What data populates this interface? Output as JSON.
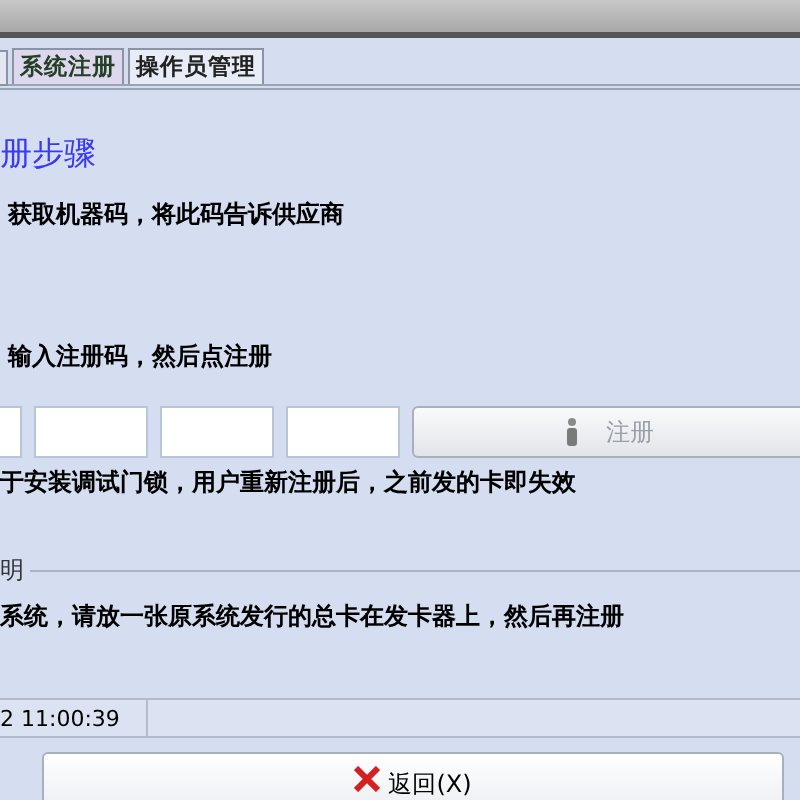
{
  "tabs": [
    {
      "label": "系统注册",
      "selected": true
    },
    {
      "label": "操作员管理",
      "selected": false
    }
  ],
  "heading": "册步骤",
  "steps": [
    "获取机器码，将此码告诉供应商",
    "输入注册码，然后点注册"
  ],
  "register_button": {
    "label": "注册",
    "disabled": true
  },
  "note": "于安装调试门锁，用户重新注册后，之前发的卡即失效",
  "group": {
    "legend": "明",
    "text": "系统，请放一张原系统发行的总卡在发卡器上，然后再注册"
  },
  "status_bar": [
    "2 11:00:39"
  ],
  "back_button": {
    "label": "返回(X)"
  }
}
